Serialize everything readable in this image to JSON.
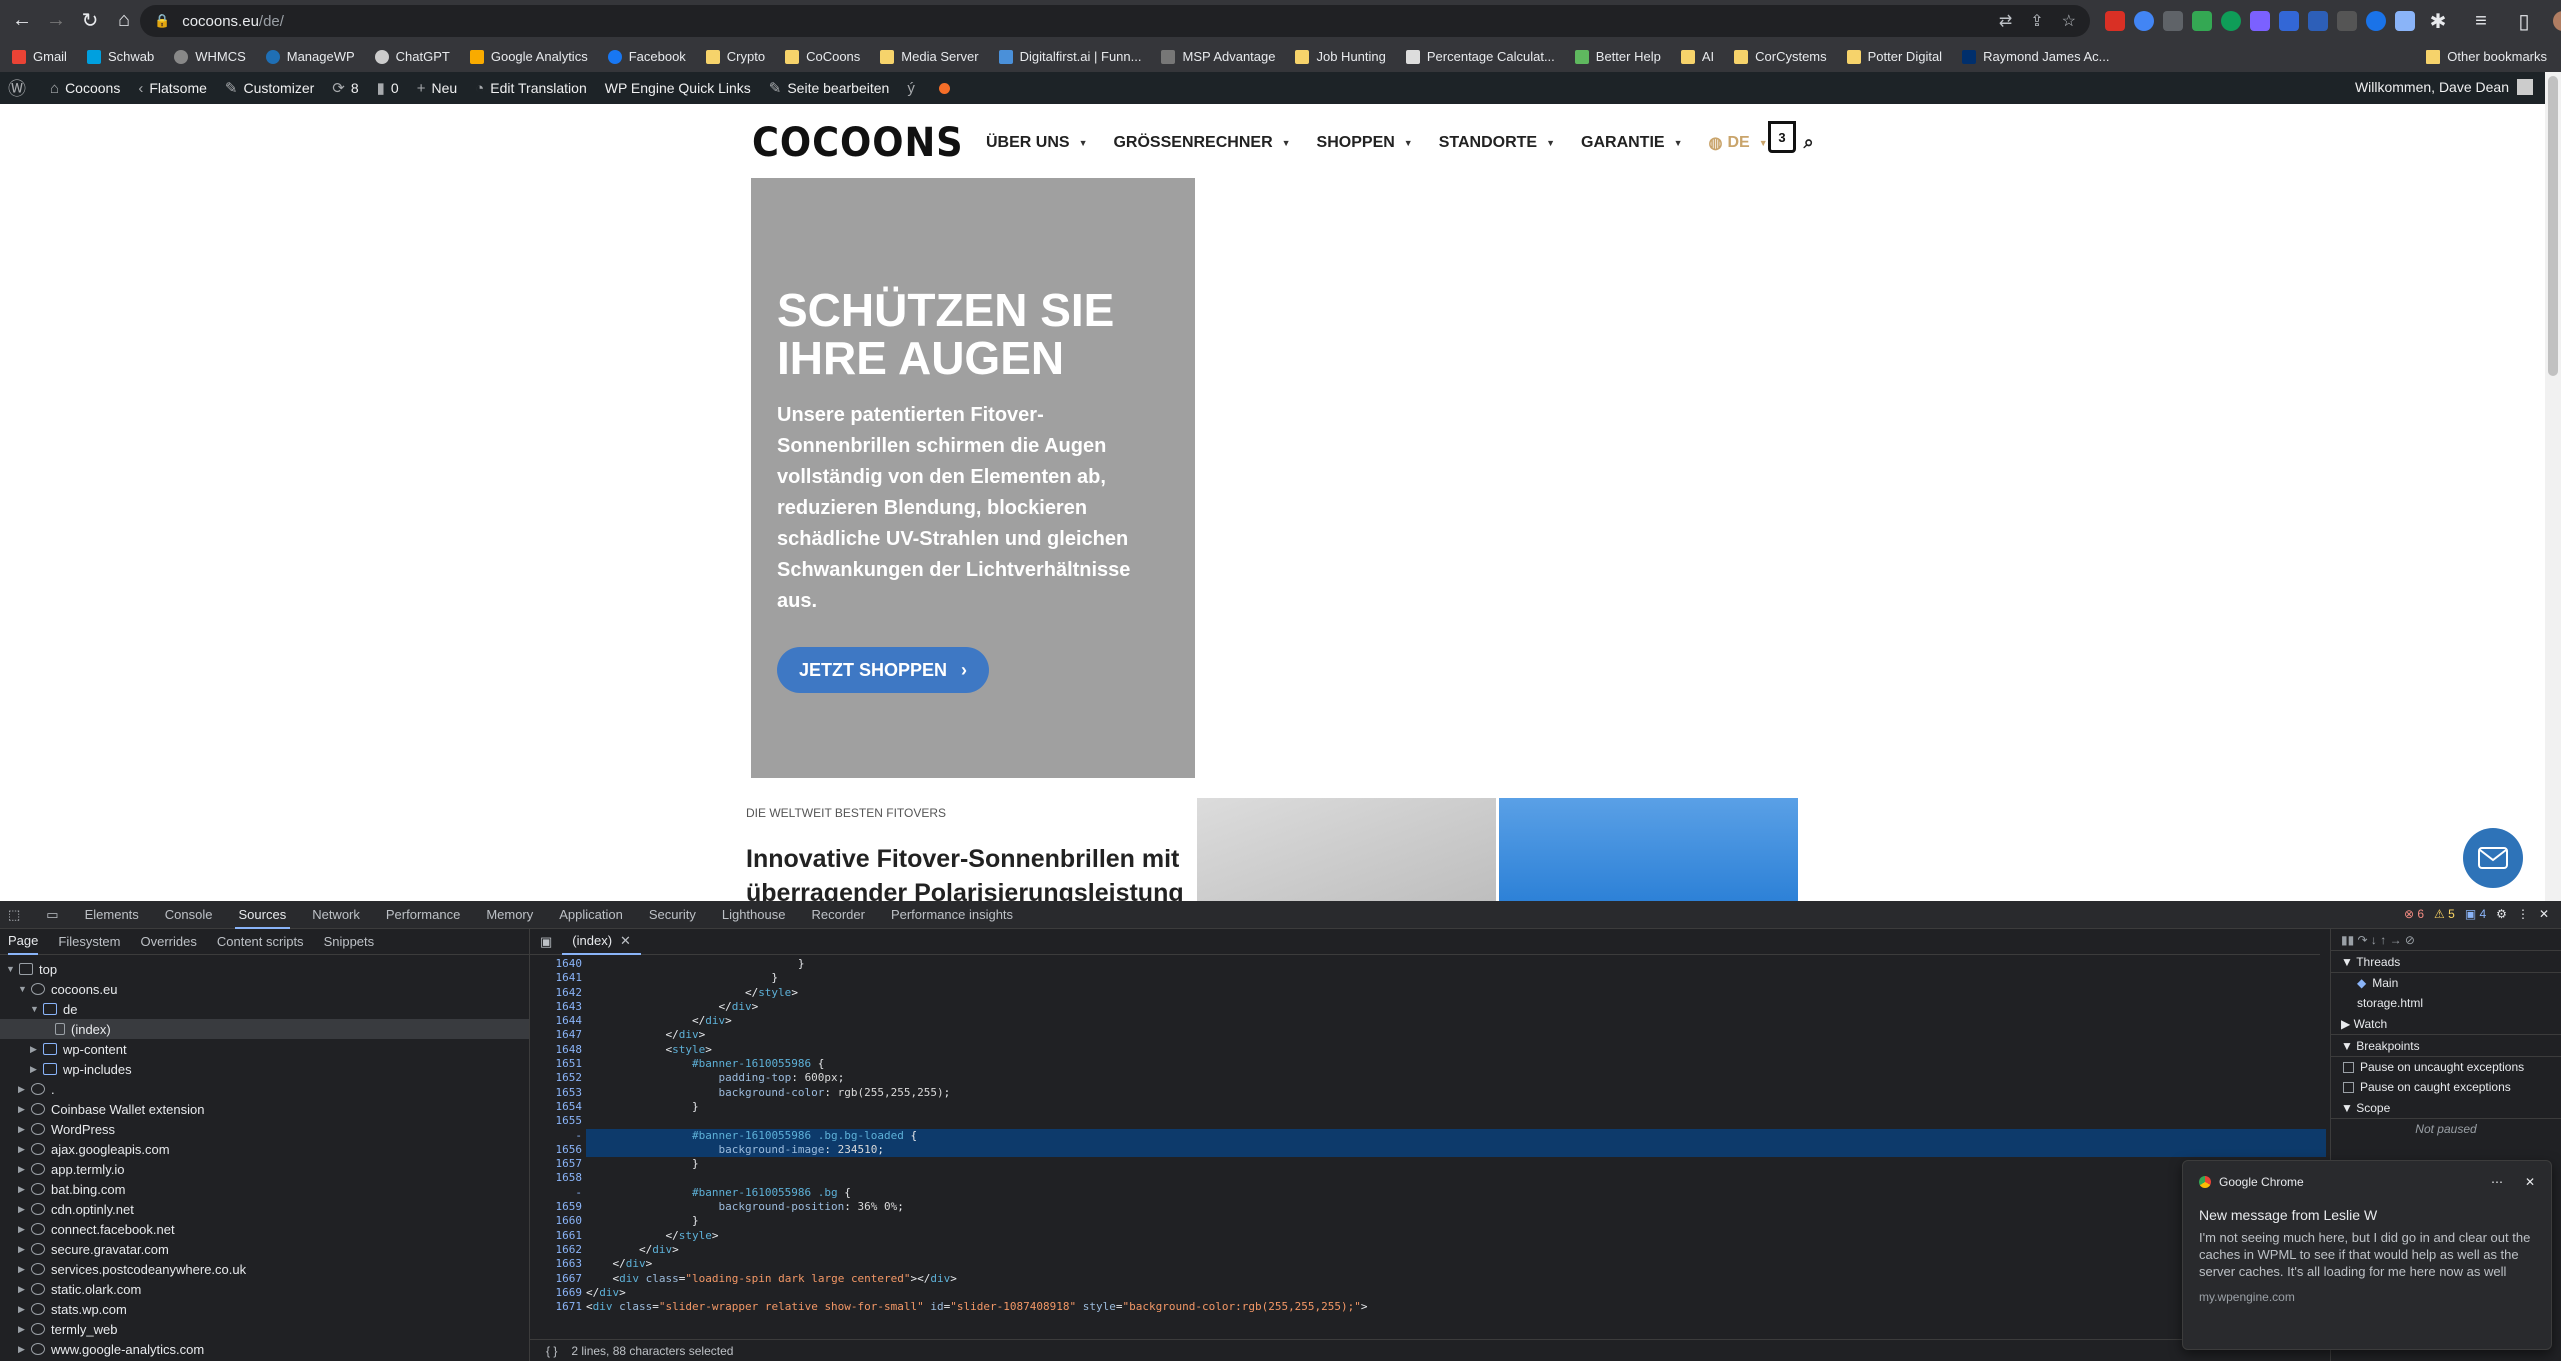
{
  "browser": {
    "url_host": "cocoons.eu",
    "url_path": "/de/"
  },
  "bookmarks": {
    "items": [
      "Gmail",
      "Schwab",
      "WHMCS",
      "ManageWP",
      "ChatGPT",
      "Google Analytics",
      "Facebook",
      "Crypto",
      "CoCoons",
      "Media Server",
      "Digitalfirst.ai | Funn...",
      "MSP Advantage",
      "Job Hunting",
      "Percentage Calculat...",
      "Better Help",
      "AI",
      "CorCystems",
      "Potter Digital",
      "Raymond James Ac..."
    ],
    "other": "Other bookmarks"
  },
  "wpbar": {
    "site": "Cocoons",
    "theme": "Flatsome",
    "customizer": "Customizer",
    "updates": "8",
    "comments": "0",
    "new": "Neu",
    "translate": "Edit Translation",
    "quicklinks": "WP Engine Quick Links",
    "edit": "Seite bearbeiten",
    "welcome": "Willkommen, Dave Dean"
  },
  "site": {
    "logo": "COCOONS",
    "nav": [
      "ÜBER UNS",
      "GRÖSSENRECHNER",
      "SHOPPEN",
      "STANDORTE",
      "GARANTIE"
    ],
    "lang": "DE",
    "cart_count": "3",
    "hero": {
      "title": "SCHÜTZEN SIE IHRE AUGEN",
      "text": "Unsere patentierten Fitover-Sonnenbrillen schirmen die Augen vollständig von den Elementen ab, reduzieren Blendung, blockieren schädliche UV-Strahlen und gleichen Schwankungen der Lichtverhältnisse aus.",
      "button": "JETZT SHOPPEN"
    },
    "kicker": "DIE WELTWEIT BESTEN FITOVERS",
    "section_title": "Innovative Fitover-Sonnenbrillen mit überragender Polarisierungsleistung"
  },
  "devtools": {
    "tabs": [
      "Elements",
      "Console",
      "Sources",
      "Network",
      "Performance",
      "Memory",
      "Application",
      "Security",
      "Lighthouse",
      "Recorder",
      "Performance insights"
    ],
    "errors": "6",
    "warnings": "5",
    "issues": "4",
    "nav_tabs": [
      "Page",
      "Filesystem",
      "Overrides",
      "Content scripts",
      "Snippets"
    ],
    "tree": [
      "top",
      "cocoons.eu",
      "de",
      "(index)",
      "wp-content",
      "wp-includes",
      ".",
      "Coinbase Wallet extension",
      "WordPress",
      "ajax.googleapis.com",
      "app.termly.io",
      "bat.bing.com",
      "cdn.optinly.net",
      "connect.facebook.net",
      "secure.gravatar.com",
      "services.postcodeanywhere.co.uk",
      "static.olark.com",
      "stats.wp.com",
      "termly_web",
      "www.google-analytics.com"
    ],
    "editor_tab": "(index)",
    "lines": [
      "1640",
      "1641",
      "1642",
      "1643",
      "1644",
      "1647",
      "1648",
      "1651",
      "1652",
      "1653",
      "1654",
      "1655",
      "-",
      "1656",
      "1657",
      "1658",
      "-",
      "1659",
      "1660",
      "1661",
      "1662",
      "1663",
      "1667",
      "1669",
      "1671"
    ],
    "status": "2 lines, 88 characters selected",
    "side": {
      "threads": "Threads",
      "main": "Main",
      "storage": "storage.html",
      "watch": "Watch",
      "breakpoints": "Breakpoints",
      "pause_uncaught": "Pause on uncaught exceptions",
      "pause_caught": "Pause on caught exceptions",
      "scope": "Scope",
      "not_paused": "Not paused"
    }
  },
  "notification": {
    "app": "Google Chrome",
    "title": "New message from Leslie W",
    "body": "I'm not seeing much here, but I did go in and clear out the caches in WPML to see if that would help as well as the server caches.  It's all loading for me here now as well",
    "site": "my.wpengine.com"
  }
}
